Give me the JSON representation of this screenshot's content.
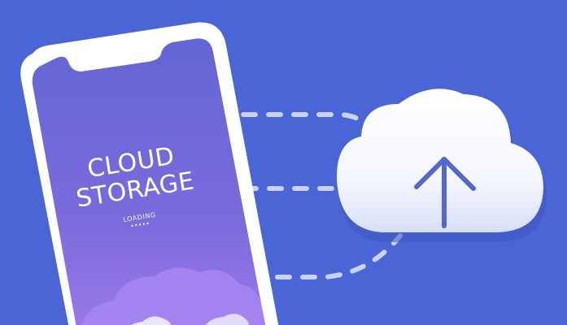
{
  "phone": {
    "title_line1": "CLOUD",
    "title_line2": "STORAGE",
    "status": "LOADING",
    "dots": "•••••"
  },
  "colors": {
    "background": "#4a66d6",
    "phone_screen_top": "#6565d4",
    "phone_screen_bottom": "#9a78e6",
    "cloud_white": "#ffffff",
    "arrow": "#5467cc",
    "dash": "#c9d3f5"
  },
  "icons": {
    "phone": "smartphone-icon",
    "cloud": "cloud-upload-icon",
    "arrow": "arrow-up-icon"
  }
}
